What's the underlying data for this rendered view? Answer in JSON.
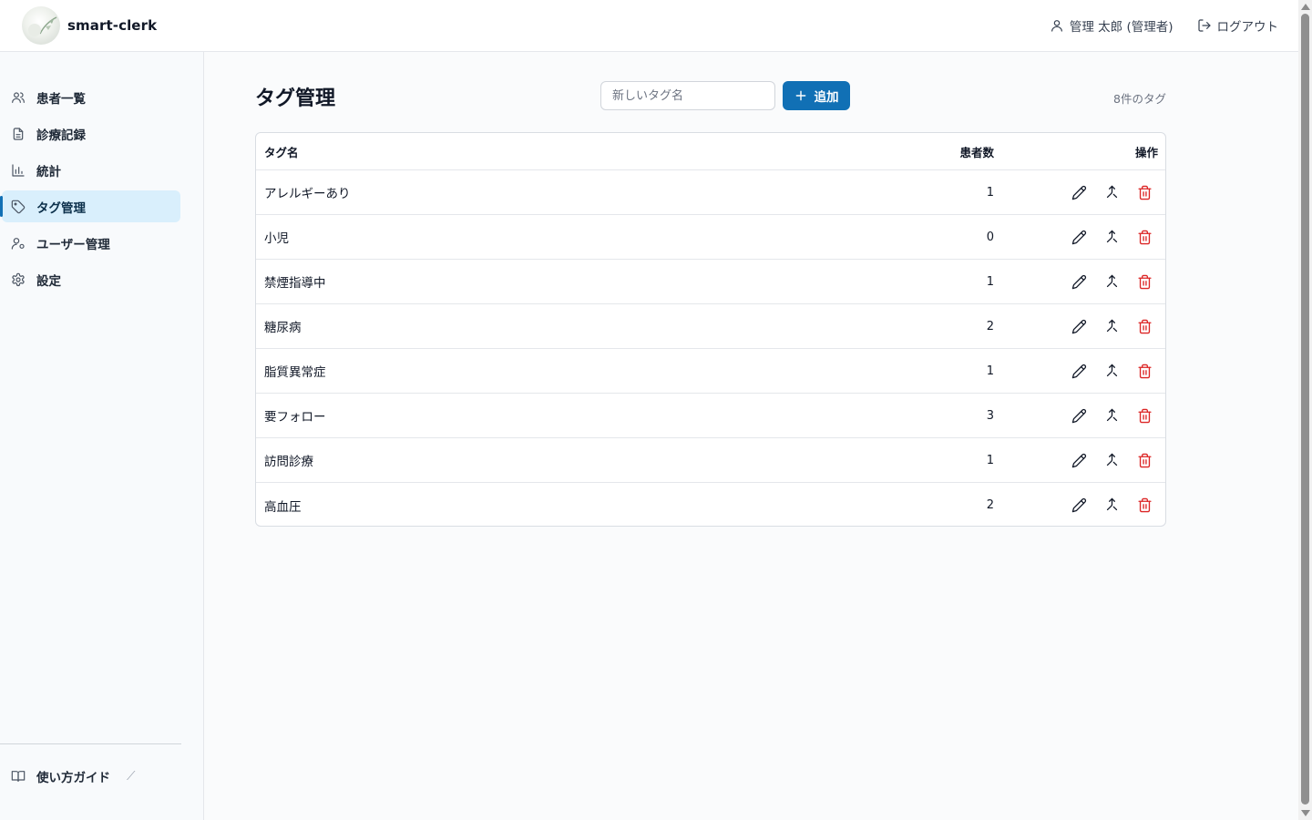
{
  "header": {
    "app_name": "smart-clerk",
    "user_label": "管理 太郎 (管理者)",
    "logout_label": "ログアウト"
  },
  "sidebar": {
    "items": [
      {
        "label": "患者一覧",
        "icon": "users-icon",
        "active": false
      },
      {
        "label": "診療記録",
        "icon": "document-icon",
        "active": false
      },
      {
        "label": "統計",
        "icon": "bar-chart-icon",
        "active": false
      },
      {
        "label": "タグ管理",
        "icon": "tag-icon",
        "active": true
      },
      {
        "label": "ユーザー管理",
        "icon": "user-cog-icon",
        "active": false
      },
      {
        "label": "設定",
        "icon": "gear-icon",
        "active": false
      }
    ],
    "guide_label": "使い方ガイド"
  },
  "main": {
    "title": "タグ管理",
    "new_tag_placeholder": "新しいタグ名",
    "new_tag_value": "",
    "add_label": "追加",
    "count_label": "8件のタグ"
  },
  "table": {
    "columns": [
      "タグ名",
      "患者数",
      "操作"
    ],
    "rows": [
      {
        "name": "アレルギーあり",
        "count": "1"
      },
      {
        "name": "小児",
        "count": "0"
      },
      {
        "name": "禁煙指導中",
        "count": "1"
      },
      {
        "name": "糖尿病",
        "count": "2"
      },
      {
        "name": "脂質異常症",
        "count": "1"
      },
      {
        "name": "要フォロー",
        "count": "3"
      },
      {
        "name": "訪問診療",
        "count": "1"
      },
      {
        "name": "高血圧",
        "count": "2"
      }
    ]
  },
  "colors": {
    "accent": "#1170b5",
    "active_bg": "#d9effc",
    "danger": "#dc2626"
  }
}
